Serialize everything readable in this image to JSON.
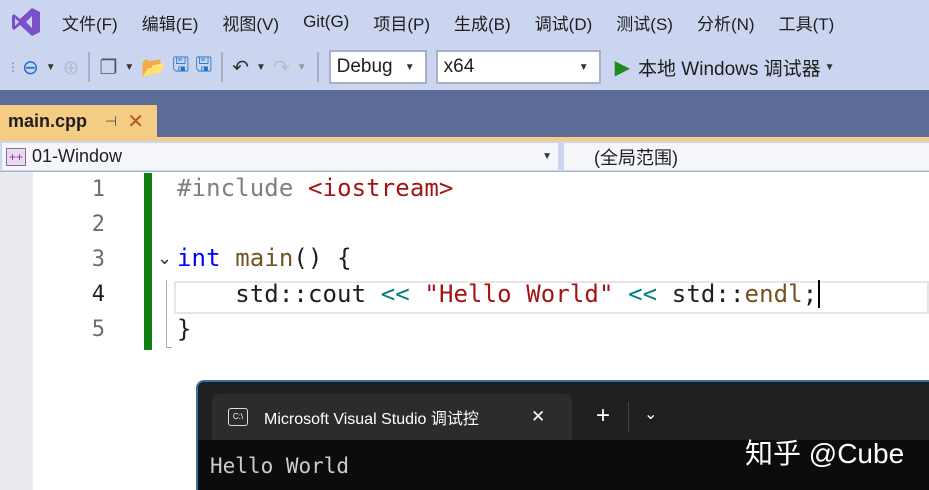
{
  "menu": [
    "文件(F)",
    "编辑(E)",
    "视图(V)",
    "Git(G)",
    "项目(P)",
    "生成(B)",
    "调试(D)",
    "测试(S)",
    "分析(N)",
    "工具(T)"
  ],
  "toolbar": {
    "config": "Debug",
    "platform": "x64",
    "run_label": "本地 Windows 调试器"
  },
  "colors": {
    "accent": "#68217a",
    "tab": "#f5cc84",
    "band": "#5d6b99",
    "run": "#1e8c1e"
  },
  "editor_tab": {
    "name": "main.cpp"
  },
  "navbar": {
    "project": "01-Window",
    "scope": "(全局范围)"
  },
  "code": {
    "line_numbers": [
      "1",
      "2",
      "3",
      "4",
      "5"
    ],
    "l1": {
      "pp": "#include",
      "inc": "<iostream>"
    },
    "l3": {
      "kw": "int",
      "fn": "main",
      "rest": "() {"
    },
    "l4": {
      "a": "std::cout",
      "op1": "<<",
      "s": "\"Hello World\"",
      "op2": "<<",
      "b": "std::",
      "c": "endl",
      "d": ";"
    },
    "l5": "}"
  },
  "terminal": {
    "tab_title": "Microsoft Visual Studio 调试控",
    "output": "Hello World"
  },
  "watermark": "知乎 @Cube"
}
